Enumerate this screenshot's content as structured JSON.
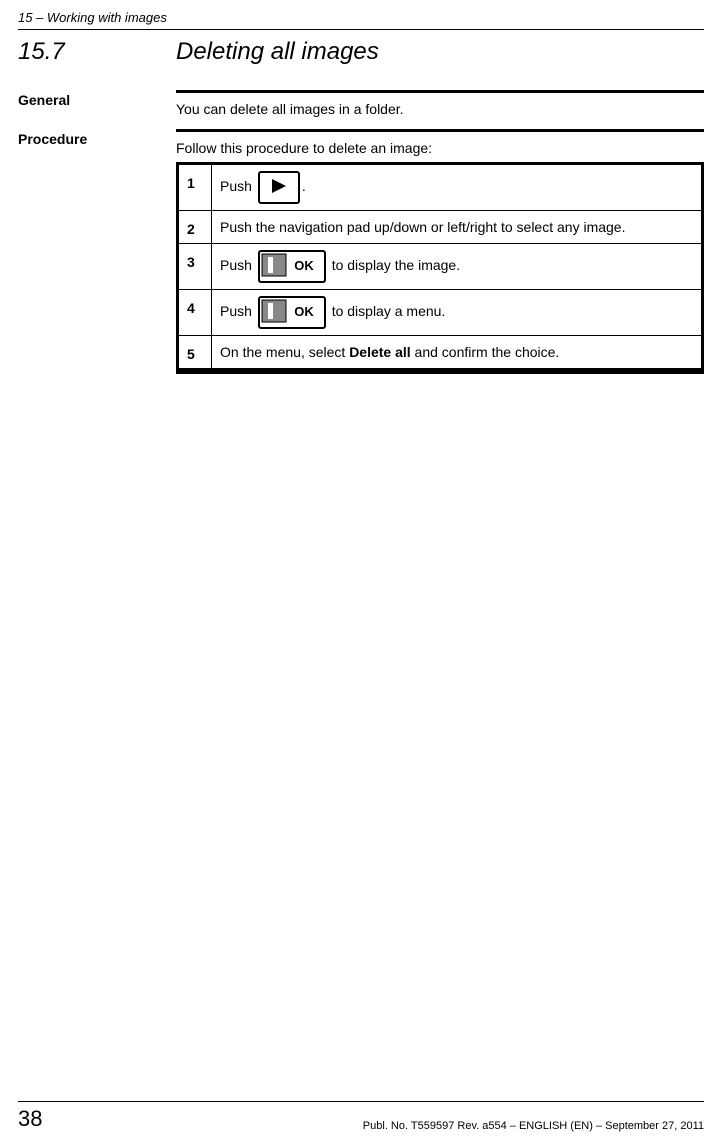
{
  "header": {
    "chapter": "15 – Working with images"
  },
  "title": {
    "number": "15.7",
    "text": "Deleting all images"
  },
  "general": {
    "label": "General",
    "text": "You can delete all images in a folder."
  },
  "procedure": {
    "label": "Procedure",
    "intro": "Follow this procedure to delete an image:",
    "steps": {
      "s1": {
        "num": "1",
        "pre": "Push ",
        "post": "."
      },
      "s2": {
        "num": "2",
        "text": "Push the navigation pad up/down or left/right to select any image."
      },
      "s3": {
        "num": "3",
        "pre": "Push ",
        "post": " to display the image."
      },
      "s4": {
        "num": "4",
        "pre": "Push ",
        "post": " to display a menu."
      },
      "s5": {
        "num": "5",
        "pre": "On the menu, select ",
        "bold": "Delete all",
        "post": " and confirm the choice."
      }
    }
  },
  "footer": {
    "page": "38",
    "pub": "Publ. No. T559597 Rev. a554 – ENGLISH (EN) – September 27, 2011"
  }
}
